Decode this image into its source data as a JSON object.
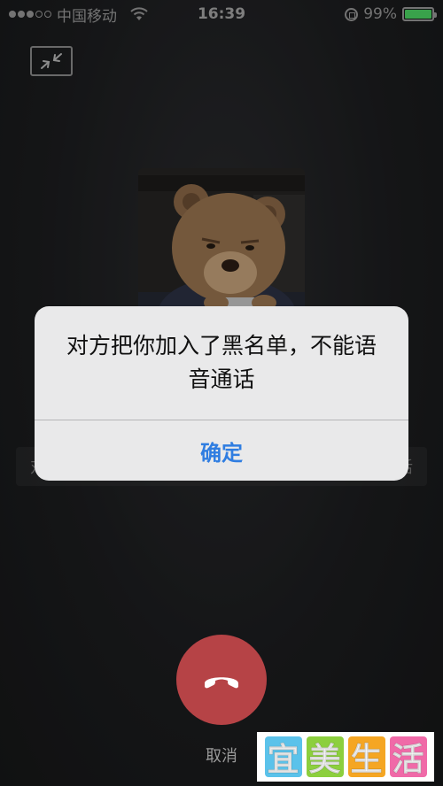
{
  "status_bar": {
    "carrier": "中国移动",
    "time": "16:39",
    "battery": "99%",
    "battery_level": 0.99
  },
  "behind": {
    "left_fragment": "对",
    "right_fragment": "活"
  },
  "alert": {
    "message": "对方把你加入了黑名单，不能语音通话",
    "confirm_label": "确定"
  },
  "call": {
    "cancel_label": "取消"
  },
  "watermark": {
    "chars": [
      "宜",
      "美",
      "生",
      "活"
    ],
    "colors": [
      "#5bc2ea",
      "#8ccf3e",
      "#f5a623",
      "#f06aa8"
    ]
  },
  "colors": {
    "hangup": "#b64346",
    "confirm": "#2f7de1",
    "battery_fill": "#4cd964"
  }
}
